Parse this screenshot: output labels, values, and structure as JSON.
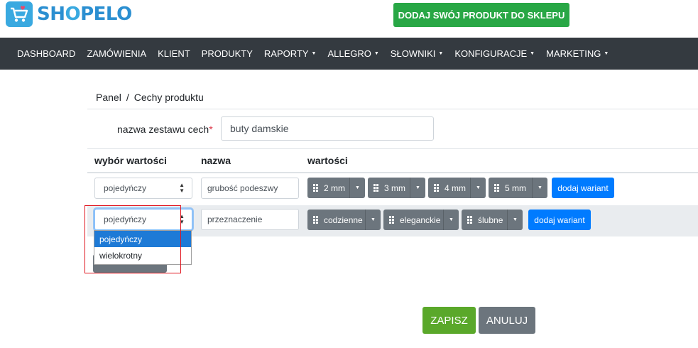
{
  "brand": {
    "name_prefix": "SH",
    "name_o": "O",
    "name_suffix": "PELO"
  },
  "header": {
    "cta_label": "DODAJ SWÓJ PRODUKT DO SKLEPU"
  },
  "nav": {
    "items": [
      {
        "label": "DASHBOARD",
        "dropdown": false
      },
      {
        "label": "ZAMÓWIENIA",
        "dropdown": false
      },
      {
        "label": "KLIENT",
        "dropdown": false
      },
      {
        "label": "PRODUKTY",
        "dropdown": false
      },
      {
        "label": "RAPORTY",
        "dropdown": true
      },
      {
        "label": "ALLEGRO",
        "dropdown": true
      },
      {
        "label": "SŁOWNIKI",
        "dropdown": true
      },
      {
        "label": "KONFIGURACJE",
        "dropdown": true
      },
      {
        "label": "MARKETING",
        "dropdown": true
      }
    ]
  },
  "breadcrumb": {
    "root": "Panel",
    "separator": "/",
    "current": "Cechy produktu"
  },
  "form": {
    "set_name_label": "nazwa zestawu cech",
    "required_mark": "*",
    "set_name_value": "buty damskie"
  },
  "table": {
    "headers": {
      "selection": "wybór wartości",
      "name": "nazwa",
      "values": "wartości"
    },
    "rows": [
      {
        "selection": "pojedyńczy",
        "name": "grubość podeszwy",
        "values": [
          "2 mm",
          "3 mm",
          "4 mm",
          "5 mm"
        ],
        "add_variant": "dodaj wariant"
      },
      {
        "selection": "pojedyńczy",
        "name": "przeznaczenie",
        "values": [
          "codzienne",
          "eleganckie",
          "ślubne"
        ],
        "add_variant": "dodaj wariant"
      }
    ]
  },
  "dropdown": {
    "options": [
      "pojedyńczy",
      "wielokrotny"
    ],
    "selected_index": 0
  },
  "actions": {
    "save": "ZAPISZ",
    "cancel": "ANULUJ"
  },
  "colors": {
    "navbar": "#343a40",
    "cta": "#28a745",
    "primary": "#007bff",
    "secondary": "#6c757d",
    "save": "#5aa82a",
    "highlight": "#e0151f"
  }
}
